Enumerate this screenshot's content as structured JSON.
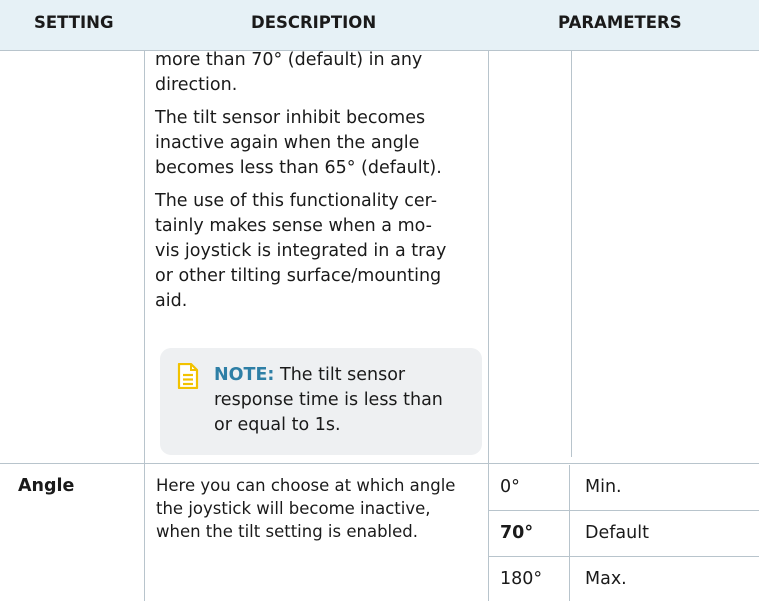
{
  "table": {
    "headers": [
      "SETTING",
      "DESCRIPTION",
      "PARAMETERS"
    ],
    "continued_row": {
      "paragraphs": [
        "more than 70° (default) in any direction.",
        "The tilt sensor inhibit becomes inactive again when the angle becomes less than 65° (default).",
        "The use of this functionality cer-tainly makes sense when a mo-vis joystick is integrated in a tray or other tilting surface/mounting aid."
      ],
      "note": {
        "label": "NOTE:",
        "text": "The tilt sensor response time is less than or equal to 1s.",
        "icon": "note-document-icon",
        "icon_color": "#f2c200"
      }
    },
    "angle_row": {
      "setting": "Angle",
      "description": "Here you can choose at which angle the joystick will become inactive, when the tilt setting is enabled.",
      "parameters": [
        {
          "value": "0°",
          "label": "Min."
        },
        {
          "value": "70°",
          "label": "Default"
        },
        {
          "value": "180°",
          "label": "Max."
        }
      ]
    }
  },
  "colors": {
    "header_bg": "#e6f1f6",
    "note_label": "#2e7fa6",
    "grid": "#b8c4cc"
  }
}
